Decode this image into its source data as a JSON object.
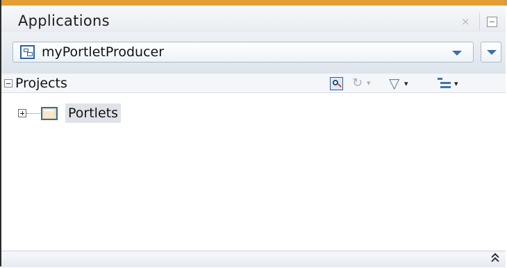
{
  "panel": {
    "title": "Applications",
    "close_icon": "close-icon",
    "minimize_icon": "minimize-icon"
  },
  "application": {
    "selected": "myPortletProducer",
    "icon": "application-icon",
    "menu_icon": "chevron-down-icon"
  },
  "projects": {
    "label": "Projects",
    "toolbar_icons": [
      "find-icon",
      "sync-icon",
      "filter-icon",
      "view-options-icon"
    ],
    "tree": [
      {
        "label": "Portlets",
        "icon": "folder-icon",
        "expanded": false
      }
    ]
  },
  "colors": {
    "accent": "#e39f34",
    "selection": "#dfe3e8",
    "icon_blue": "#2f6ea8"
  }
}
